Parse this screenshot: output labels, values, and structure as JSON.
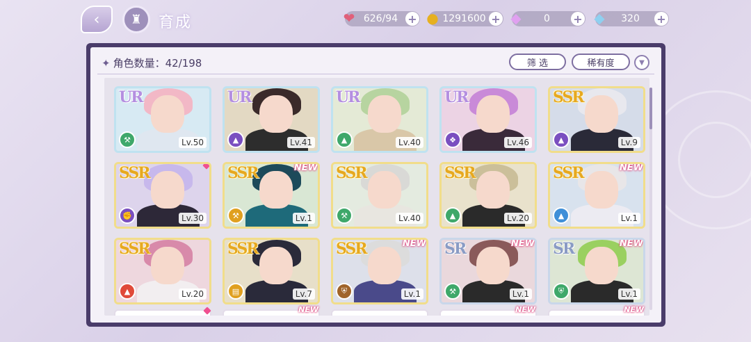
{
  "header": {
    "title": "育成",
    "back_icon": "back-arrow-icon",
    "home_icon": "castle-home-icon"
  },
  "resources": [
    {
      "name": "candy",
      "icon": "candy-icon",
      "value": "626/94",
      "color": "#e0607a"
    },
    {
      "name": "coin",
      "icon": "gold-coin-icon",
      "value": "1291600",
      "color": "#e6b020"
    },
    {
      "name": "pink-diamond",
      "icon": "pink-diamond-icon",
      "value": "0",
      "color": "#e0a0f0"
    },
    {
      "name": "blue-diamond",
      "icon": "blue-diamond-icon",
      "value": "320",
      "color": "#8fd0f0"
    }
  ],
  "panel": {
    "count_label": "角色数量：42/198",
    "filter_label": "筛 选",
    "sort_label": "稀有度",
    "sort_icon": "sort-toggle-icon"
  },
  "characters": [
    {
      "rarity": "UR",
      "level": "Lv.50",
      "class_color": "#3fa86a",
      "class_icon": "wrench-icon",
      "new": false,
      "dot": false,
      "hair": "#f2b8c6",
      "outfit": "#dfe7f0",
      "bg": "#d7eaf3"
    },
    {
      "rarity": "UR",
      "level": "Lv.41",
      "class_color": "#7a4fc0",
      "class_icon": "boot-icon",
      "new": false,
      "dot": false,
      "hair": "#3a2a2a",
      "outfit": "#2d2d2d",
      "bg": "#e3d9c3"
    },
    {
      "rarity": "UR",
      "level": "Lv.40",
      "class_color": "#3fa86a",
      "class_icon": "boot-icon",
      "new": false,
      "dot": false,
      "hair": "#b7d4a0",
      "outfit": "#d9c7a8",
      "bg": "#e4ead6"
    },
    {
      "rarity": "UR",
      "level": "Lv.46",
      "class_color": "#7a4fc0",
      "class_icon": "wing-icon",
      "new": false,
      "dot": false,
      "hair": "#c98ad8",
      "outfit": "#3a2a3a",
      "bg": "#ecd3e4"
    },
    {
      "rarity": "SSR",
      "level": "Lv.9",
      "class_color": "#7a4fc0",
      "class_icon": "boot-icon",
      "new": false,
      "dot": false,
      "hair": "#e8e8ee",
      "outfit": "#2a2a38",
      "bg": "#d5dce9"
    },
    {
      "rarity": "SSR",
      "level": "Lv.30",
      "class_color": "#7a4fc0",
      "class_icon": "fist-icon",
      "new": false,
      "dot": true,
      "hair": "#c7b8ec",
      "outfit": "#2d2838",
      "bg": "#ddd4ec"
    },
    {
      "rarity": "SSR",
      "level": "Lv.1",
      "class_color": "#e0a020",
      "class_icon": "hammer-icon",
      "new": true,
      "dot": false,
      "hair": "#1d4a5a",
      "outfit": "#1e6a7a",
      "bg": "#d9e7d4"
    },
    {
      "rarity": "SSR",
      "level": "Lv.40",
      "class_color": "#3fa86a",
      "class_icon": "wrench-icon",
      "new": false,
      "dot": false,
      "hair": "#d9d9d6",
      "outfit": "#e8e6e0",
      "bg": "#e4ebe0"
    },
    {
      "rarity": "SSR",
      "level": "Lv.20",
      "class_color": "#3fa86a",
      "class_icon": "boot-icon",
      "new": false,
      "dot": false,
      "hair": "#cbbf9a",
      "outfit": "#2a2a2a",
      "bg": "#e9e2cc"
    },
    {
      "rarity": "SSR",
      "level": "Lv.1",
      "class_color": "#3f8fd8",
      "class_icon": "boot-icon",
      "new": true,
      "dot": false,
      "hair": "#e8e6e8",
      "outfit": "#ecebf2",
      "bg": "#d8e2ee"
    },
    {
      "rarity": "SSR",
      "level": "Lv.20",
      "class_color": "#e04a3a",
      "class_icon": "boot-icon",
      "new": false,
      "dot": false,
      "hair": "#d88aaa",
      "outfit": "#f2eef0",
      "bg": "#eed7de"
    },
    {
      "rarity": "SSR",
      "level": "Lv.7",
      "class_color": "#e0a020",
      "class_icon": "book-icon",
      "new": false,
      "dot": false,
      "hair": "#2a2a3a",
      "outfit": "#2a2a3a",
      "bg": "#e7dfc9"
    },
    {
      "rarity": "SSR",
      "level": "Lv.1",
      "class_color": "#a0642a",
      "class_icon": "shield-icon",
      "new": true,
      "dot": false,
      "hair": "#dcdcdc",
      "outfit": "#4a4a8a",
      "bg": "#dde0ea"
    },
    {
      "rarity": "SR",
      "level": "Lv.1",
      "class_color": "#3fa86a",
      "class_icon": "wrench-icon",
      "new": true,
      "dot": false,
      "hair": "#8a5a5a",
      "outfit": "#2a2a2a",
      "bg": "#ead8dc"
    },
    {
      "rarity": "SR",
      "level": "Lv.1",
      "class_color": "#3fa86a",
      "class_icon": "shield-icon",
      "new": true,
      "dot": false,
      "hair": "#9ad060",
      "outfit": "#2a2a2a",
      "bg": "#dde6d4"
    }
  ],
  "partial_row": [
    {
      "dot": true,
      "new": false
    },
    {
      "dot": false,
      "new": true
    },
    {
      "dot": false,
      "new": false
    },
    {
      "dot": false,
      "new": true
    },
    {
      "dot": false,
      "new": true
    }
  ],
  "new_text": "NEW"
}
